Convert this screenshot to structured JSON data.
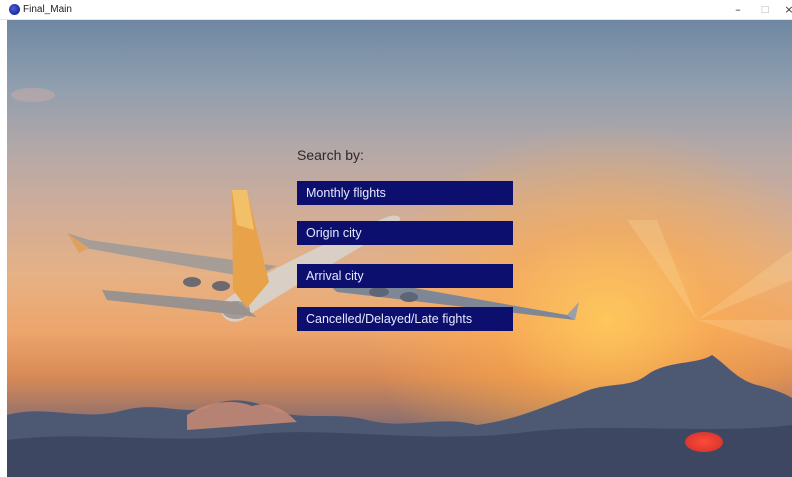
{
  "window": {
    "title": "Final_Main",
    "controls": {
      "minimize": "–",
      "maximize": "□",
      "close": "×"
    },
    "app_icon": "processing-app-icon"
  },
  "menu": {
    "heading": "Search by:",
    "items": [
      {
        "label": "Monthly flights"
      },
      {
        "label": "Origin city"
      },
      {
        "label": "Arrival city"
      },
      {
        "label": "Cancelled/Delayed/Late fights"
      }
    ],
    "button_color": "#0d0f6e",
    "button_text_color": "#e6e9ff"
  },
  "background": {
    "image": "airplane-sunset-sky",
    "accent_colors": [
      "#6f87a2",
      "#e6b184",
      "#d88a56",
      "#4a5370"
    ]
  }
}
